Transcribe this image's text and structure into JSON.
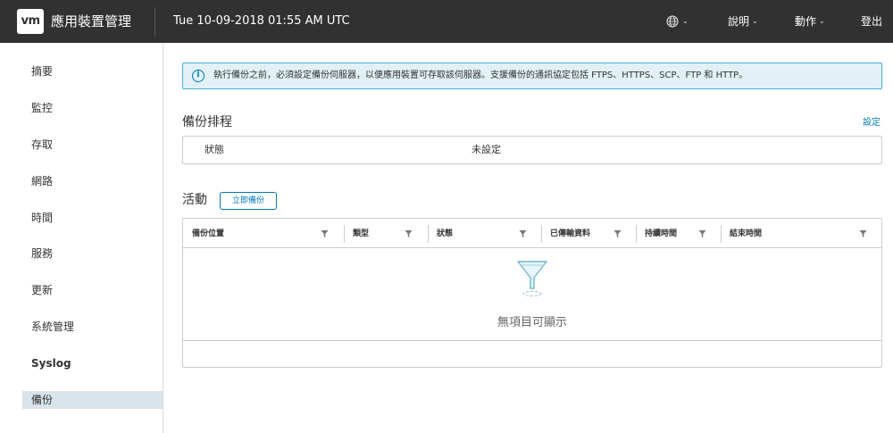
{
  "header": {
    "logo_text": "vm",
    "app_title": "應用裝置管理",
    "datetime": "Tue 10-09-2018 01:55 AM UTC",
    "help_label": "說明",
    "actions_label": "動作",
    "logout_label": "登出"
  },
  "sidebar": {
    "items": [
      {
        "label": "摘要"
      },
      {
        "label": "監控"
      },
      {
        "label": "存取"
      },
      {
        "label": "網路"
      },
      {
        "label": "時間"
      },
      {
        "label": "服務"
      },
      {
        "label": "更新"
      },
      {
        "label": "系統管理"
      },
      {
        "label": "Syslog"
      },
      {
        "label": "備份"
      }
    ],
    "active": "備份"
  },
  "alert": {
    "message": "執行備份之前，必須設定備份伺服器，以便應用裝置可存取該伺服器。支援備份的通訊協定包括 FTPS、HTTPS、SCP、FTP 和 HTTP。"
  },
  "schedule": {
    "title": "備份排程",
    "settings_link": "設定",
    "status_label": "狀態",
    "status_value": "未設定"
  },
  "activity": {
    "title": "活動",
    "backup_now_label": "立即備份",
    "columns": [
      {
        "label": "備份位置"
      },
      {
        "label": "類型"
      },
      {
        "label": "狀態"
      },
      {
        "label": "已傳輸資料"
      },
      {
        "label": "持續時間"
      },
      {
        "label": "結束時間"
      }
    ],
    "empty_message": "無項目可顯示"
  },
  "colors": {
    "header_bg": "#313131",
    "accent": "#0079b8",
    "alert_bg": "#e1f1f6",
    "alert_border": "#49afd9",
    "active_nav_bg": "#d9e4ea"
  }
}
